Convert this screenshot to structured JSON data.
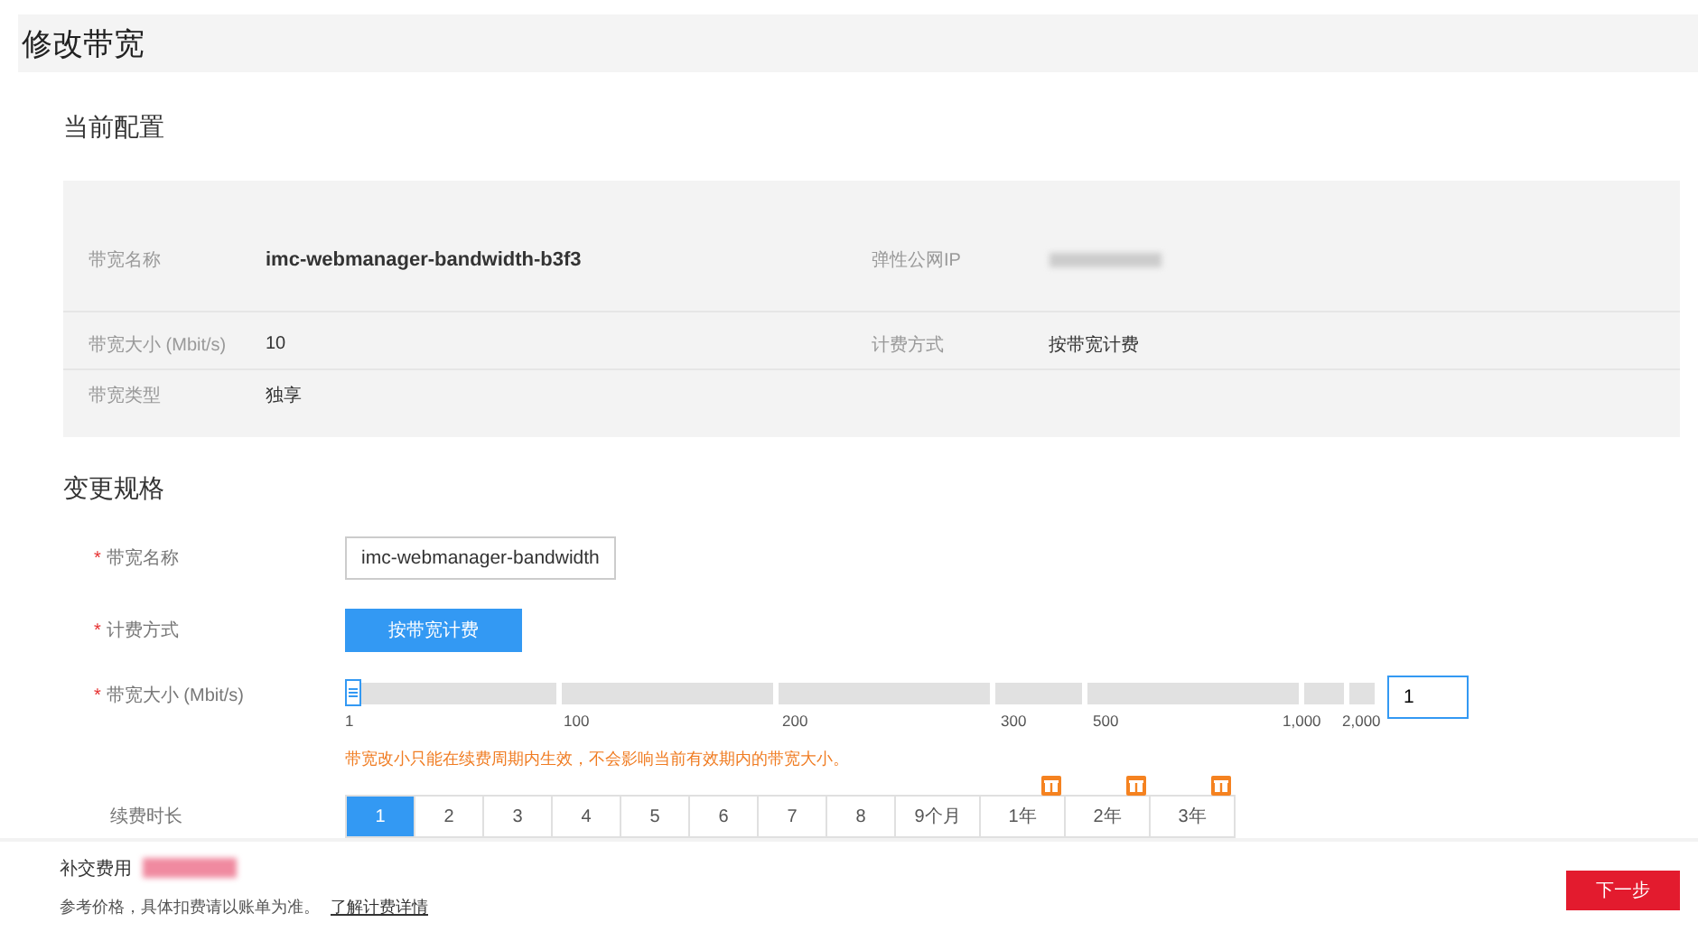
{
  "page_title": "修改带宽",
  "current": {
    "title": "当前配置",
    "rows": [
      [
        {
          "label": "带宽名称",
          "value": "imc-webmanager-bandwidth-b3f3",
          "kind": "bold"
        },
        {
          "label": "弹性公网IP",
          "kind": "blurred"
        }
      ],
      [
        {
          "label": "带宽大小 (Mbit/s)",
          "value": "10",
          "kind": "text"
        },
        {
          "label": "计费方式",
          "value": "按带宽计费",
          "kind": "text"
        }
      ],
      [
        {
          "label": "带宽类型",
          "value": "独享",
          "kind": "text"
        }
      ]
    ]
  },
  "change": {
    "title": "变更规格",
    "name_field": {
      "label": "带宽名称",
      "required_mark": "*",
      "value": "imc-webmanager-bandwidth"
    },
    "billing": {
      "label": "计费方式",
      "required_mark": "*",
      "button": "按带宽计费"
    },
    "size": {
      "label": "带宽大小 (Mbit/s)",
      "required_mark": "*",
      "ticks": [
        "1",
        "100",
        "200",
        "300",
        "500",
        "1,000",
        "2,000"
      ],
      "input_value": "1",
      "hint": "带宽改小只能在续费周期内生效，不会影响当前有效期内的带宽大小。"
    },
    "duration": {
      "label": "续费时长",
      "options": [
        {
          "label": "1",
          "selected": true,
          "badge": false
        },
        {
          "label": "2",
          "selected": false,
          "badge": false
        },
        {
          "label": "3",
          "selected": false,
          "badge": false
        },
        {
          "label": "4",
          "selected": false,
          "badge": false
        },
        {
          "label": "5",
          "selected": false,
          "badge": false
        },
        {
          "label": "6",
          "selected": false,
          "badge": false
        },
        {
          "label": "7",
          "selected": false,
          "badge": false
        },
        {
          "label": "8",
          "selected": false,
          "badge": false
        },
        {
          "label": "9个月",
          "selected": false,
          "badge": false
        },
        {
          "label": "1年",
          "selected": false,
          "badge": true
        },
        {
          "label": "2年",
          "selected": false,
          "badge": true
        },
        {
          "label": "3年",
          "selected": false,
          "badge": true
        }
      ]
    }
  },
  "footer": {
    "fee_label": "补交费用",
    "note": "参考价格，具体扣费请以账单为准。",
    "link": "了解计费详情",
    "next_button": "下一步"
  }
}
